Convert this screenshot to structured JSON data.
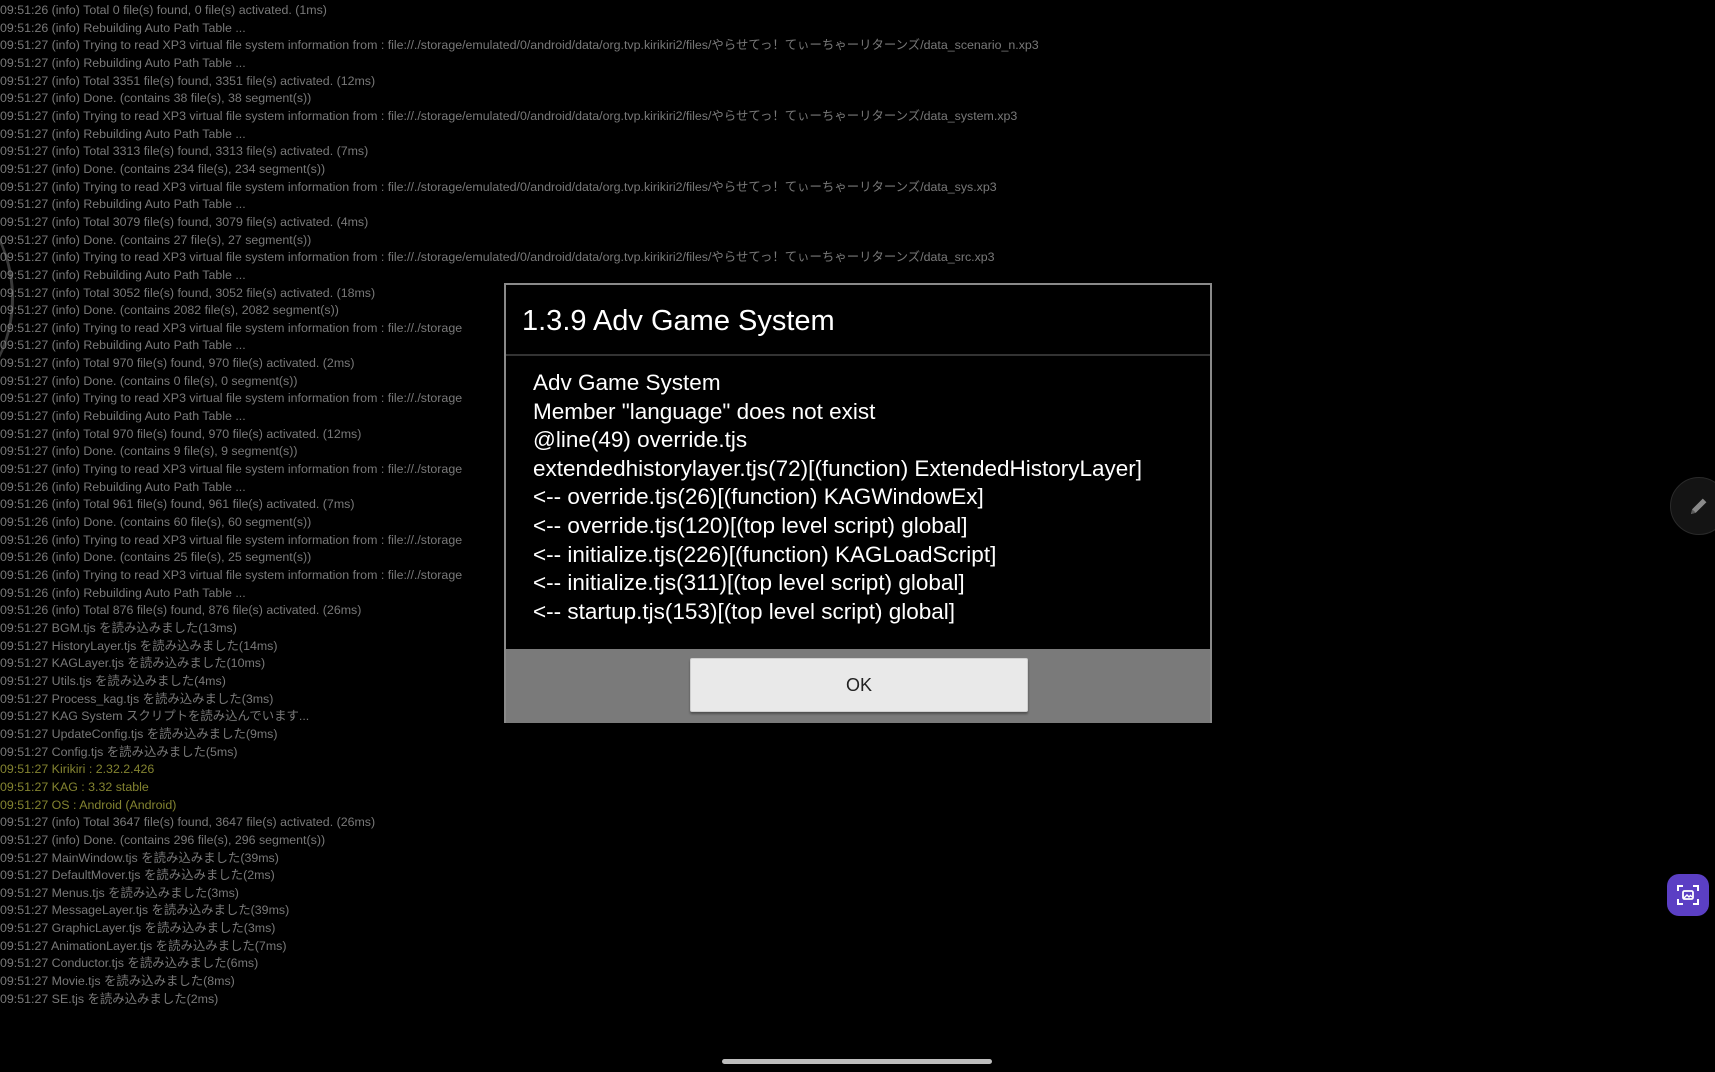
{
  "log_lines": [
    {
      "text": "09:51:26 (info) Total 0 file(s) found, 0 file(s) activated. (1ms)",
      "color": "default"
    },
    {
      "text": "09:51:26 (info) Rebuilding Auto Path Table ...",
      "color": "default"
    },
    {
      "text": "09:51:27 (info) Trying to read XP3 virtual file system information from : file://./storage/emulated/0/android/data/org.tvp.kirikiri2/files/やらせてっ！てぃーちゃーリターンズ/data_scenario_n.xp3",
      "color": "default"
    },
    {
      "text": "09:51:27 (info) Rebuilding Auto Path Table ...",
      "color": "default"
    },
    {
      "text": "09:51:27 (info) Total 3351 file(s) found, 3351 file(s) activated. (12ms)",
      "color": "default"
    },
    {
      "text": "09:51:27 (info) Done. (contains 38 file(s), 38 segment(s))",
      "color": "default"
    },
    {
      "text": "09:51:27 (info) Trying to read XP3 virtual file system information from : file://./storage/emulated/0/android/data/org.tvp.kirikiri2/files/やらせてっ！てぃーちゃーリターンズ/data_system.xp3",
      "color": "default"
    },
    {
      "text": "09:51:27 (info) Rebuilding Auto Path Table ...",
      "color": "default"
    },
    {
      "text": "09:51:27 (info) Total 3313 file(s) found, 3313 file(s) activated. (7ms)",
      "color": "default"
    },
    {
      "text": "09:51:27 (info) Done. (contains 234 file(s), 234 segment(s))",
      "color": "default"
    },
    {
      "text": "09:51:27 (info) Trying to read XP3 virtual file system information from : file://./storage/emulated/0/android/data/org.tvp.kirikiri2/files/やらせてっ！てぃーちゃーリターンズ/data_sys.xp3",
      "color": "default"
    },
    {
      "text": "09:51:27 (info) Rebuilding Auto Path Table ...",
      "color": "default"
    },
    {
      "text": "09:51:27 (info) Total 3079 file(s) found, 3079 file(s) activated. (4ms)",
      "color": "default"
    },
    {
      "text": "09:51:27 (info) Done. (contains 27 file(s), 27 segment(s))",
      "color": "default"
    },
    {
      "text": "09:51:27 (info) Trying to read XP3 virtual file system information from : file://./storage/emulated/0/android/data/org.tvp.kirikiri2/files/やらせてっ！てぃーちゃーリターンズ/data_src.xp3",
      "color": "default"
    },
    {
      "text": "09:51:27 (info) Rebuilding Auto Path Table ...",
      "color": "default"
    },
    {
      "text": "09:51:27 (info) Total 3052 file(s) found, 3052 file(s) activated. (18ms)",
      "color": "default"
    },
    {
      "text": "09:51:27 (info) Done. (contains 2082 file(s), 2082 segment(s))",
      "color": "default"
    },
    {
      "text": "09:51:27 (info) Trying to read XP3 virtual file system information from : file://./storage",
      "color": "default"
    },
    {
      "text": "09:51:27 (info) Rebuilding Auto Path Table ...",
      "color": "default"
    },
    {
      "text": "09:51:27 (info) Total 970 file(s) found, 970 file(s) activated. (2ms)",
      "color": "default"
    },
    {
      "text": "09:51:27 (info) Done. (contains 0 file(s), 0 segment(s))",
      "color": "default"
    },
    {
      "text": "09:51:27 (info) Trying to read XP3 virtual file system information from : file://./storage",
      "color": "default"
    },
    {
      "text": "09:51:27 (info) Rebuilding Auto Path Table ...",
      "color": "default"
    },
    {
      "text": "09:51:27 (info) Total 970 file(s) found, 970 file(s) activated. (12ms)",
      "color": "default"
    },
    {
      "text": "09:51:27 (info) Done. (contains 9 file(s), 9 segment(s))",
      "color": "default"
    },
    {
      "text": "09:51:27 (info) Trying to read XP3 virtual file system information from : file://./storage",
      "color": "default"
    },
    {
      "text": "09:51:26 (info) Rebuilding Auto Path Table ...",
      "color": "default"
    },
    {
      "text": "09:51:26 (info) Total 961 file(s) found, 961 file(s) activated. (7ms)",
      "color": "default"
    },
    {
      "text": "09:51:26 (info) Done. (contains 60 file(s), 60 segment(s))",
      "color": "default"
    },
    {
      "text": "09:51:26 (info) Trying to read XP3 virtual file system information from : file://./storage",
      "color": "default"
    },
    {
      "text": "09:51:26 (info) Done. (contains 25 file(s), 25 segment(s))",
      "color": "default"
    },
    {
      "text": "09:51:26 (info) Trying to read XP3 virtual file system information from : file://./storage",
      "color": "default"
    },
    {
      "text": "09:51:26 (info) Rebuilding Auto Path Table ...",
      "color": "default"
    },
    {
      "text": "09:51:26 (info) Total 876 file(s) found, 876 file(s) activated. (26ms)",
      "color": "default"
    },
    {
      "text": "09:51:27 BGM.tjs を読み込みました(13ms)",
      "color": "default"
    },
    {
      "text": "09:51:27 HistoryLayer.tjs を読み込みました(14ms)",
      "color": "default"
    },
    {
      "text": "09:51:27 KAGLayer.tjs を読み込みました(10ms)",
      "color": "default"
    },
    {
      "text": "09:51:27 Utils.tjs を読み込みました(4ms)",
      "color": "default"
    },
    {
      "text": "09:51:27 Process_kag.tjs を読み込みました(3ms)",
      "color": "default"
    },
    {
      "text": "09:51:27 KAG System スクリプトを読み込んでいます...",
      "color": "default"
    },
    {
      "text": "09:51:27 UpdateConfig.tjs を読み込みました(9ms)",
      "color": "default"
    },
    {
      "text": "09:51:27 Config.tjs を読み込みました(5ms)",
      "color": "default"
    },
    {
      "text": "09:51:27 Kirikiri : 2.32.2.426",
      "color": "yellow"
    },
    {
      "text": "09:51:27 KAG : 3.32 stable",
      "color": "yellow"
    },
    {
      "text": "09:51:27 OS : Android (Android)",
      "color": "yellow"
    },
    {
      "text": "09:51:27 (info) Total 3647 file(s) found, 3647 file(s) activated. (26ms)",
      "color": "default"
    },
    {
      "text": "09:51:27 (info) Done. (contains 296 file(s), 296 segment(s))",
      "color": "default"
    },
    {
      "text": "09:51:27 MainWindow.tjs を読み込みました(39ms)",
      "color": "default"
    },
    {
      "text": "09:51:27 DefaultMover.tjs を読み込みました(2ms)",
      "color": "default"
    },
    {
      "text": "09:51:27 Menus.tjs を読み込みました(3ms)",
      "color": "default"
    },
    {
      "text": "09:51:27 MessageLayer.tjs を読み込みました(39ms)",
      "color": "default"
    },
    {
      "text": "09:51:27 GraphicLayer.tjs を読み込みました(3ms)",
      "color": "default"
    },
    {
      "text": "09:51:27 AnimationLayer.tjs を読み込みました(7ms)",
      "color": "default"
    },
    {
      "text": "09:51:27 Conductor.tjs を読み込みました(6ms)",
      "color": "default"
    },
    {
      "text": "09:51:27 Movie.tjs を読み込みました(8ms)",
      "color": "default"
    },
    {
      "text": "09:51:27 SE.tjs を読み込みました(2ms)",
      "color": "default"
    }
  ],
  "dialog": {
    "title": "1.3.9 Adv Game System",
    "message_lines": [
      "Adv Game System",
      "Member \"language\" does not exist",
      "@line(49) override.tjs",
      "extendedhistorylayer.tjs(72)[(function) ExtendedHistoryLayer]",
      "<-- override.tjs(26)[(function) KAGWindowEx]",
      "<-- override.tjs(120)[(top level script) global]",
      "<-- initialize.tjs(226)[(function) KAGLoadScript]",
      "<-- initialize.tjs(311)[(top level script) global]",
      "<-- startup.tjs(153)[(top level script) global]"
    ],
    "ok_label": "OK"
  },
  "floating_controls": {
    "pencil_icon": "pencil-icon",
    "screenshot_icon": "screenshot-capture-icon"
  },
  "colors": {
    "background": "#000000",
    "log_text": "#b9b9b9",
    "log_highlight": "#c9c94a",
    "dialog_footer": "#7a7a7a",
    "screenshot_fab": "#5b3fc4"
  }
}
